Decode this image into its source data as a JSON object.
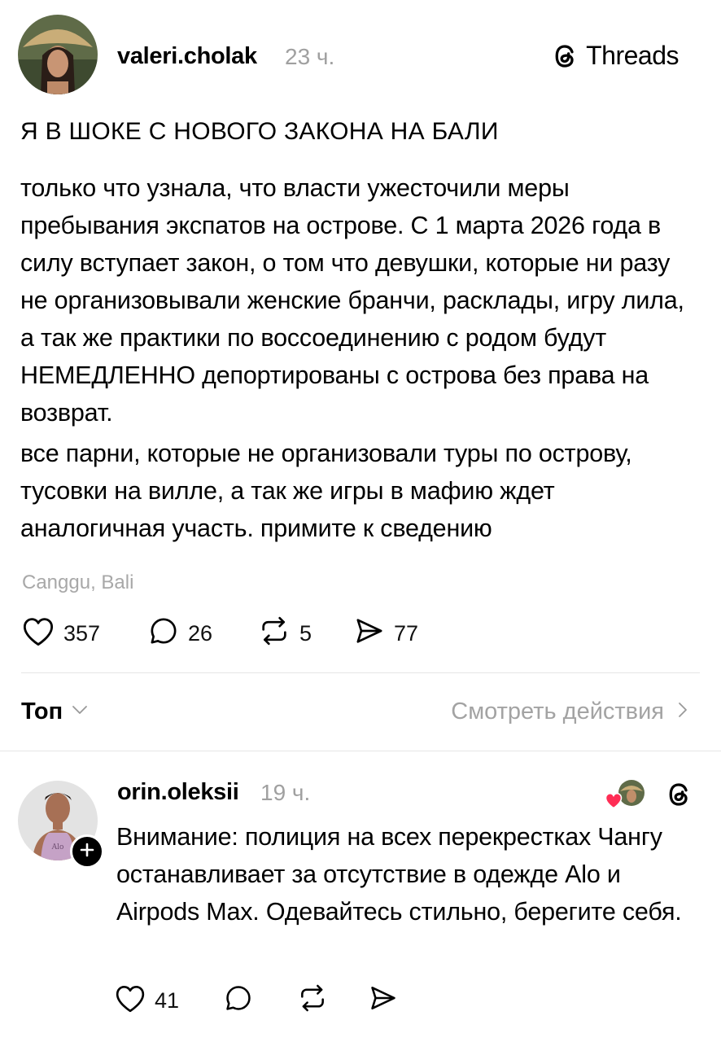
{
  "brand": {
    "name": "Threads"
  },
  "post": {
    "username": "valeri.cholak",
    "time": "23 ч.",
    "title": "Я В ШОКЕ С НОВОГО ЗАКОНА НА БАЛИ",
    "paragraph1": "только что узнала, что власти ужесточили меры пребывания экспатов на острове. С 1 марта 2026 года в силу вступает закон, о том что девушки, которые ни разу не организовывали женские бранчи, расклады, игру лила, а так же практики по воссоединению с родом будут НЕМЕДЛЕННО депортированы с острова без права на возврат.",
    "paragraph2": "все парни, которые не организовали туры по острову, тусовки на вилле, а так же игры в мафию ждет аналогичная участь. примите к сведению",
    "location": "Canggu, Bali",
    "stats": {
      "likes": "357",
      "comments": "26",
      "reposts": "5",
      "shares": "77"
    }
  },
  "sort": {
    "label": "Топ",
    "view_activity": "Смотреть действия"
  },
  "comment": {
    "username": "orin.oleksii",
    "time": "19 ч.",
    "text": "Внимание: полиция на всех перекрестках Чангу останавливает за отсутствие в одежде Alo и Airpods Max. Одевайтесь стильно, берегите себя.",
    "likes": "41"
  }
}
